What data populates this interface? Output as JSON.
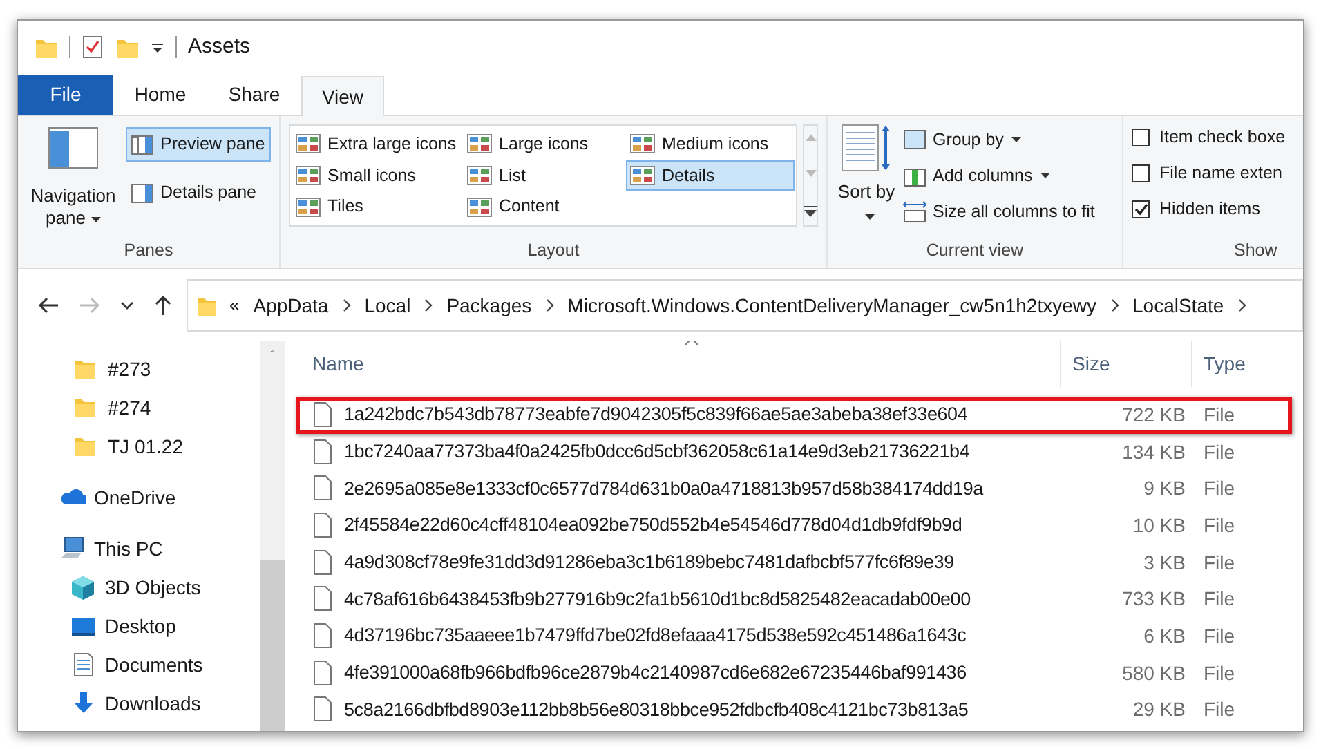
{
  "title_bar": {
    "title": "Assets"
  },
  "ribbon_tabs": [
    {
      "label": "File",
      "kind": "file",
      "selected": false
    },
    {
      "label": "Home",
      "kind": "tab",
      "selected": false
    },
    {
      "label": "Share",
      "kind": "tab",
      "selected": false
    },
    {
      "label": "View",
      "kind": "tab",
      "selected": true
    }
  ],
  "ribbon": {
    "panes": {
      "label": "Panes",
      "navigation_pane": "Navigation pane",
      "buttons": [
        {
          "label": "Preview pane",
          "selected": true
        },
        {
          "label": "Details pane",
          "selected": false
        }
      ]
    },
    "layout": {
      "label": "Layout",
      "options": [
        {
          "label": "Extra large icons",
          "selected": false
        },
        {
          "label": "Small icons",
          "selected": false
        },
        {
          "label": "Tiles",
          "selected": false
        },
        {
          "label": "Large icons",
          "selected": false
        },
        {
          "label": "List",
          "selected": false
        },
        {
          "label": "Content",
          "selected": false
        },
        {
          "label": "Medium icons",
          "selected": false
        },
        {
          "label": "Details",
          "selected": true
        }
      ]
    },
    "current_view": {
      "label": "Current view",
      "sort_by": "Sort by",
      "buttons": [
        "Group by",
        "Add columns",
        "Size all columns to fit"
      ]
    },
    "show": {
      "label": "Show",
      "checkboxes": [
        {
          "label": "Item check boxe",
          "checked": false
        },
        {
          "label": "File name exten",
          "checked": false
        },
        {
          "label": "Hidden items",
          "checked": true
        }
      ]
    }
  },
  "address_bar": {
    "overflow": "«",
    "path": [
      "AppData",
      "Local",
      "Packages",
      "Microsoft.Windows.ContentDeliveryManager_cw5n1h2txyewy",
      "LocalState"
    ]
  },
  "navigation": [
    {
      "label": "#273",
      "kind": "folder"
    },
    {
      "label": "#274",
      "kind": "folder"
    },
    {
      "label": "TJ 01.22",
      "kind": "folder"
    },
    {
      "label": "OneDrive",
      "kind": "cloud"
    },
    {
      "label": "This PC",
      "kind": "pc",
      "children": [
        {
          "label": "3D Objects",
          "kind": "cube"
        },
        {
          "label": "Desktop",
          "kind": "desktop"
        },
        {
          "label": "Documents",
          "kind": "documents"
        },
        {
          "label": "Downloads",
          "kind": "downloads"
        }
      ]
    }
  ],
  "table": {
    "columns": [
      "Name",
      "Size",
      "Type"
    ],
    "rows": [
      {
        "name": "1a242bdc7b543db78773eabfe7d9042305f5c839f66ae5ae3abeba38ef33e604",
        "size": "722 KB",
        "type": "File",
        "highlighted": true
      },
      {
        "name": "1bc7240aa77373ba4f0a2425fb0dcc6d5cbf362058c61a14e9d3eb21736221b4",
        "size": "134 KB",
        "type": "File",
        "highlighted": false
      },
      {
        "name": "2e2695a085e8e1333cf0c6577d784d631b0a0a4718813b957d58b384174dd19a",
        "size": "9 KB",
        "type": "File",
        "highlighted": false
      },
      {
        "name": "2f45584e22d60c4cff48104ea092be750d552b4e54546d778d04d1db9fdf9b9d",
        "size": "10 KB",
        "type": "File",
        "highlighted": false
      },
      {
        "name": "4a9d308cf78e9fe31dd3d91286eba3c1b6189bebc7481dafbcbf577fc6f89e39",
        "size": "3 KB",
        "type": "File",
        "highlighted": false
      },
      {
        "name": "4c78af616b6438453fb9b277916b9c2fa1b5610d1bc8d5825482eacadab00e00",
        "size": "733 KB",
        "type": "File",
        "highlighted": false
      },
      {
        "name": "4d37196bc735aaeee1b7479ffd7be02fd8efaaa4175d538e592c451486a1643c",
        "size": "6 KB",
        "type": "File",
        "highlighted": false
      },
      {
        "name": "4fe391000a68fb966bdfb96ce2879b4c2140987cd6e682e67235446baf991436",
        "size": "580 KB",
        "type": "File",
        "highlighted": false
      },
      {
        "name": "5c8a2166dbfbd8903e112bb8b56e80318bbce952fdbcfb408c4121bc73b813a5",
        "size": "29 KB",
        "type": "File",
        "highlighted": false
      }
    ]
  }
}
